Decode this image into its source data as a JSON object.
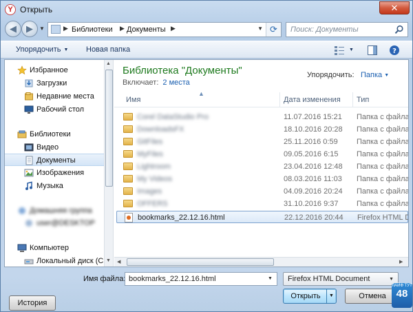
{
  "window": {
    "title": "Открыть",
    "app_icon": "Y",
    "close_glyph": "✕"
  },
  "address": {
    "crumbs": [
      "Библиотеки",
      "Документы"
    ],
    "search_placeholder": "Поиск: Документы"
  },
  "toolbar": {
    "organize": "Упорядочить",
    "new_folder": "Новая папка"
  },
  "nav_pane": {
    "items": [
      {
        "label": "Избранное",
        "icon": "star-icon"
      },
      {
        "label": "Загрузки",
        "icon": "downloads-icon"
      },
      {
        "label": "Недавние места",
        "icon": "recent-icon"
      },
      {
        "label": "Рабочий стол",
        "icon": "desktop-icon"
      },
      {
        "label": "Библиотеки",
        "icon": "library-icon"
      },
      {
        "label": "Видео",
        "icon": "video-icon"
      },
      {
        "label": "Документы",
        "icon": "documents-icon"
      },
      {
        "label": "Изображения",
        "icon": "images-icon"
      },
      {
        "label": "Музыка",
        "icon": "music-icon"
      },
      {
        "label": "Домашняя группа",
        "icon": "homegroup-icon"
      },
      {
        "label": "user@DESKTOP",
        "icon": "user-icon"
      },
      {
        "label": "Компьютер",
        "icon": "computer-icon"
      },
      {
        "label": "Локальный диск (C",
        "icon": "drive-icon"
      }
    ]
  },
  "library": {
    "title": "Библиотека \"Документы\"",
    "includes_label": "Включает:",
    "includes_link": "2 места",
    "arrange_label": "Упорядочить:",
    "arrange_value": "Папка"
  },
  "columns": {
    "name": "Имя",
    "date": "Дата изменения",
    "type": "Тип"
  },
  "rows": [
    {
      "name": "Corel DataStudio Pro",
      "date": "11.07.2016 15:21",
      "type": "Папка с файлами"
    },
    {
      "name": "DownloadsFX",
      "date": "18.10.2016 20:28",
      "type": "Папка с файлами"
    },
    {
      "name": "GitFiles",
      "date": "25.11.2016 0:59",
      "type": "Папка с файлами"
    },
    {
      "name": "MyFiles",
      "date": "09.05.2016 6:15",
      "type": "Папка с файлами"
    },
    {
      "name": "Lightroom",
      "date": "23.04.2016 12:48",
      "type": "Папка с файлами"
    },
    {
      "name": "My Videos",
      "date": "08.03.2016 11:03",
      "type": "Папка с файлами"
    },
    {
      "name": "Images",
      "date": "04.09.2016 20:24",
      "type": "Папка с файлами"
    },
    {
      "name": "OFFERS",
      "date": "31.10.2016 9:37",
      "type": "Папка с файлами"
    },
    {
      "name": "bookmarks_22.12.16.html",
      "date": "22.12.2016 20:44",
      "type": "Firefox HTML Document"
    }
  ],
  "bottom": {
    "filename_label": "Имя файла:",
    "filename_value": "bookmarks_22.12.16.html",
    "filetype_value": "Firefox HTML Document",
    "history_button": "История",
    "open_button": "Открыть",
    "cancel_button": "Отмена"
  },
  "watermark": {
    "top": "ЛАЙФ ТУТ",
    "big": "48"
  }
}
